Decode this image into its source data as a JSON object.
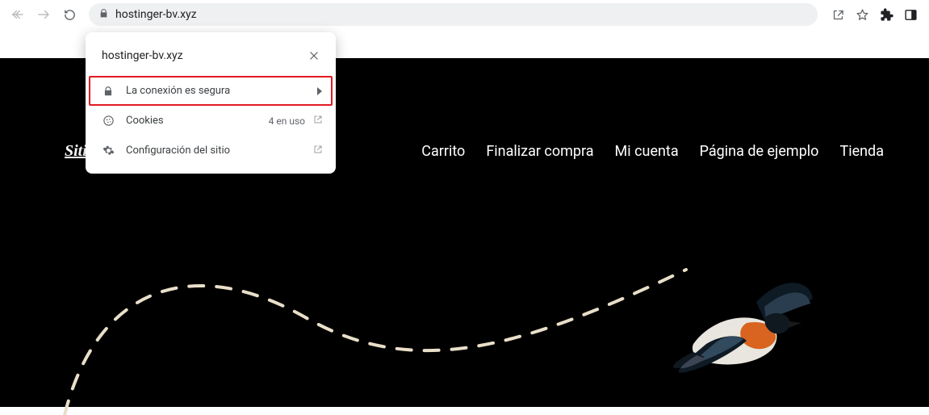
{
  "browser": {
    "url": "hostinger-bv.xyz"
  },
  "site_popup": {
    "title": "hostinger-bv.xyz",
    "rows": {
      "secure": {
        "label": "La conexión es segura"
      },
      "cookies": {
        "label": "Cookies",
        "trail": "4 en uso"
      },
      "settings": {
        "label": "Configuración del sitio"
      }
    }
  },
  "site": {
    "title_fragment": "Siti",
    "nav": {
      "cart": "Carrito",
      "checkout": "Finalizar compra",
      "account": "Mi cuenta",
      "sample": "Página de ejemplo",
      "shop": "Tienda"
    }
  }
}
